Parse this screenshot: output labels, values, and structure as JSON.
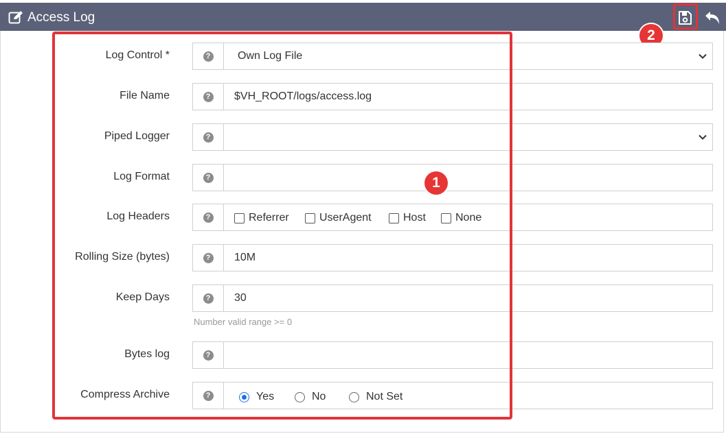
{
  "header": {
    "title": "Access Log",
    "icons": {
      "title": "edit-icon",
      "save": "save-icon",
      "back": "undo-icon"
    }
  },
  "markers": {
    "form": "1",
    "save": "2"
  },
  "accent": {
    "highlight": "#e0343a",
    "header_bg": "#5b6178",
    "radio_active": "#1a73e8"
  },
  "form": {
    "log_control": {
      "label": "Log Control *",
      "value": "Own Log File"
    },
    "file_name": {
      "label": "File Name",
      "value": "$VH_ROOT/logs/access.log"
    },
    "piped_logger": {
      "label": "Piped Logger",
      "value": ""
    },
    "log_format": {
      "label": "Log Format",
      "value": ""
    },
    "log_headers": {
      "label": "Log Headers",
      "options": [
        "Referrer",
        "UserAgent",
        "Host",
        "None"
      ]
    },
    "rolling_size": {
      "label": "Rolling Size (bytes)",
      "value": "10M"
    },
    "keep_days": {
      "label": "Keep Days",
      "value": "30",
      "hint": "Number valid range >= 0"
    },
    "bytes_log": {
      "label": "Bytes log",
      "value": ""
    },
    "compress_archive": {
      "label": "Compress Archive",
      "options": [
        "Yes",
        "No",
        "Not Set"
      ],
      "selected": "Yes"
    }
  }
}
